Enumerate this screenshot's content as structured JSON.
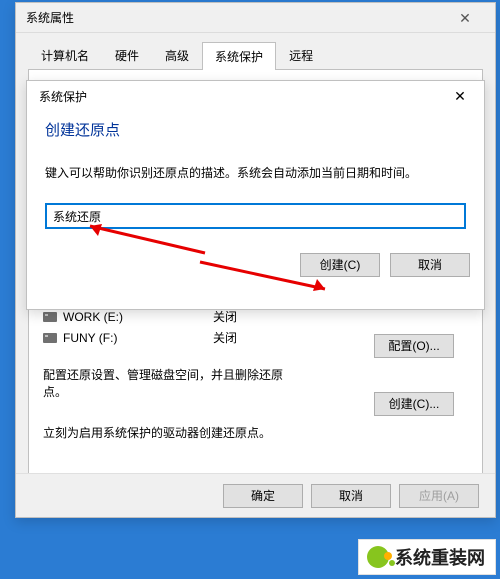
{
  "main_window": {
    "title": "系统属性",
    "tabs": {
      "t0": "计算机名",
      "t1": "硬件",
      "t2": "高级",
      "t3": "系统保护",
      "t4": "远程"
    },
    "drives": [
      {
        "name": "WORK (E:)",
        "status": "关闭"
      },
      {
        "name": "FUNY (F:)",
        "status": "关闭"
      }
    ],
    "config_text": "配置还原设置、管理磁盘空间，并且删除还原点。",
    "config_btn": "配置(O)...",
    "create_text": "立刻为启用系统保护的驱动器创建还原点。",
    "create_btn": "创建(C)...",
    "ok": "确定",
    "cancel": "取消",
    "apply": "应用(A)"
  },
  "modal": {
    "title": "系统保护",
    "heading": "创建还原点",
    "desc": "键入可以帮助你识别还原点的描述。系统会自动添加当前日期和时间。",
    "input_value": "系统还原",
    "create": "创建(C)",
    "cancel": "取消"
  },
  "watermark": "系统重装网"
}
